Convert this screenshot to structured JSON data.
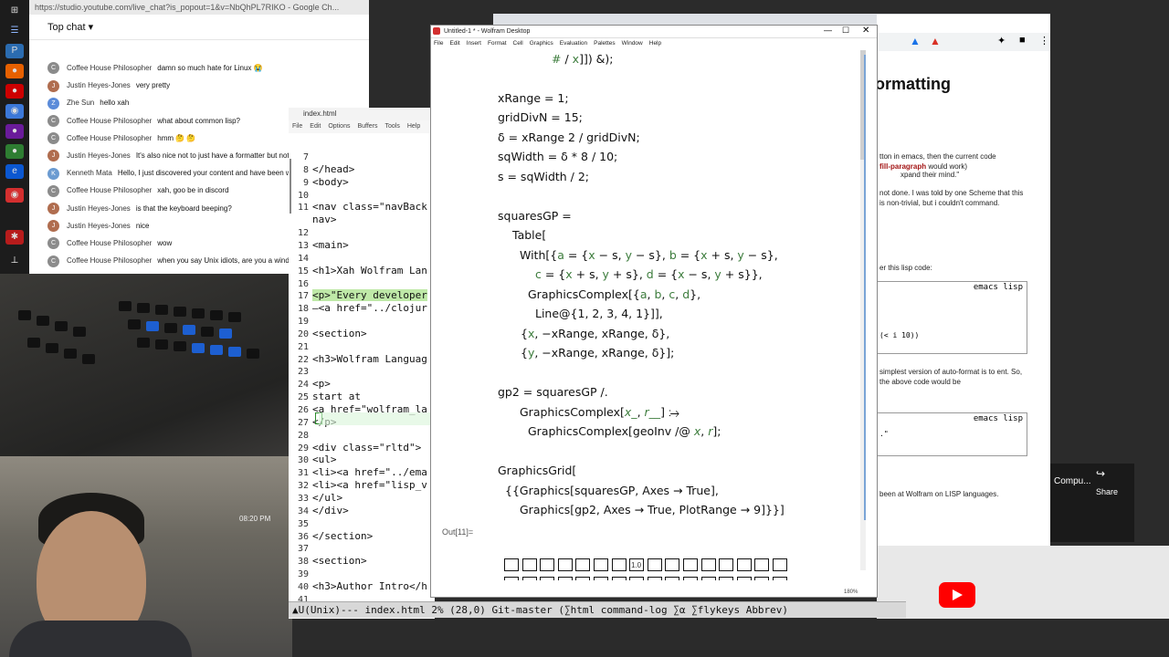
{
  "chat": {
    "url": "https://studio.youtube.com/live_chat?is_popout=1&v=NbQhPL7RIKO - Google Ch...",
    "header": "Top chat",
    "messages": [
      {
        "author": "Coffee House Philosopher",
        "text": "damn so much hate for Linux 😭",
        "color": "#8b8b8b"
      },
      {
        "author": "Justin Heyes-Jones",
        "text": "very pretty",
        "color": "#b06d4f"
      },
      {
        "author": "Zhe Sun",
        "text": "hello xah",
        "color": "#5b8bd9"
      },
      {
        "author": "Coffee House Philosopher",
        "text": "what about common lisp?",
        "color": "#8b8b8b"
      },
      {
        "author": "Coffee House Philosopher",
        "text": "hmm 🤔 🤔",
        "color": "#8b8b8b"
      },
      {
        "author": "Justin Heyes-Jones",
        "text": "It's also nice not to just have a formatter but not about the config settings",
        "color": "#b06d4f"
      },
      {
        "author": "Kenneth Mata",
        "text": "Hello, I just discovered your content and have been wa your previous streams",
        "color": "#6b9bd1"
      },
      {
        "author": "Coffee House Philosopher",
        "text": "xah, goo be in discord",
        "color": "#8b8b8b"
      },
      {
        "author": "Justin Heyes-Jones",
        "text": "is that the keyboard beeping?",
        "color": "#b06d4f"
      },
      {
        "author": "Justin Heyes-Jones",
        "text": "nice",
        "color": "#b06d4f"
      },
      {
        "author": "Coffee House Philosopher",
        "text": "wow",
        "color": "#8b8b8b"
      },
      {
        "author": "Coffee House Philosopher",
        "text": "when you say Unix idiots, are you a wind",
        "color": "#8b8b8b"
      }
    ]
  },
  "clock": "08:20 PM",
  "emacs": {
    "title": "index.html",
    "menu": [
      "File",
      "Edit",
      "Options",
      "Buffers",
      "Tools",
      "Help"
    ],
    "lines": [
      {
        "n": "7",
        "t": ""
      },
      {
        "n": "8",
        "t": "</head>"
      },
      {
        "n": "9",
        "t": "<body>"
      },
      {
        "n": "10",
        "t": ""
      },
      {
        "n": "11",
        "t": "<nav class=\"navBack"
      },
      {
        "n": "",
        "t": "nav>"
      },
      {
        "n": "12",
        "t": ""
      },
      {
        "n": "13",
        "t": "<main>"
      },
      {
        "n": "14",
        "t": ""
      },
      {
        "n": "15",
        "t": "<h1>Xah Wolfram Lan"
      },
      {
        "n": "16",
        "t": ""
      },
      {
        "n": "17",
        "t": "<p>\"Every developer"
      },
      {
        "n": "18",
        "t": "—<a href=\"../clojur"
      },
      {
        "n": "19",
        "t": ""
      },
      {
        "n": "20",
        "t": "<section>"
      },
      {
        "n": "21",
        "t": ""
      },
      {
        "n": "22",
        "t": "<h3>Wolfram Languag"
      },
      {
        "n": "23",
        "t": ""
      },
      {
        "n": "24",
        "t": "<p>"
      },
      {
        "n": "25",
        "t": "start at"
      },
      {
        "n": "26",
        "t": "<a href=\"wolfram_la"
      },
      {
        "n": "27",
        "t": "</p>"
      },
      {
        "n": "28",
        "t": ""
      },
      {
        "n": "29",
        "t": "<div class=\"rltd\">"
      },
      {
        "n": "30",
        "t": "<ul>"
      },
      {
        "n": "31",
        "t": "<li><a href=\"../ema"
      },
      {
        "n": "32",
        "t": "<li><a href=\"lisp_v"
      },
      {
        "n": "33",
        "t": "</ul>"
      },
      {
        "n": "34",
        "t": "</div>"
      },
      {
        "n": "35",
        "t": ""
      },
      {
        "n": "36",
        "t": "</section>"
      },
      {
        "n": "37",
        "t": ""
      },
      {
        "n": "38",
        "t": "<section>"
      },
      {
        "n": "39",
        "t": ""
      },
      {
        "n": "40",
        "t": "<h3>Author Intro</h"
      },
      {
        "n": "41",
        "t": ""
      },
      {
        "n": "42",
        "t": "<p>"
      }
    ],
    "modeline": "▲U(Unix)--- index.html 2% (28,0) Git-master (∑html command-log ∑α ∑flykeys Abbrev)"
  },
  "wolfram": {
    "title": "Untitled-1 * - Wolfram Desktop",
    "menu": [
      "File",
      "Edit",
      "Insert",
      "Format",
      "Cell",
      "Graphics",
      "Evaluation",
      "Palettes",
      "Window",
      "Help"
    ],
    "out_label": "Out[11]=",
    "zoom": "180%",
    "tick_label": "1.0"
  },
  "right_page": {
    "heading": "ormatting",
    "p1": "tton in emacs, then the current code",
    "p1b": "fill-paragraph",
    "p1c": "would work)",
    "p2": "xpand their mind.\"",
    "p3": "not done. I was told by one Scheme that this is non-trivial, but i couldn't command.",
    "p4": "er this lisp code:",
    "code1_label": "emacs lisp",
    "code1_text": "(< i 10))",
    "p5": "simplest version of auto-format is to ent. So, the above code would be",
    "code2_label": "emacs lisp",
    "code2_text": ".\"",
    "p6": "been at Wolfram on LISP languages.",
    "yt_card": "Compu...",
    "share": "Share"
  }
}
